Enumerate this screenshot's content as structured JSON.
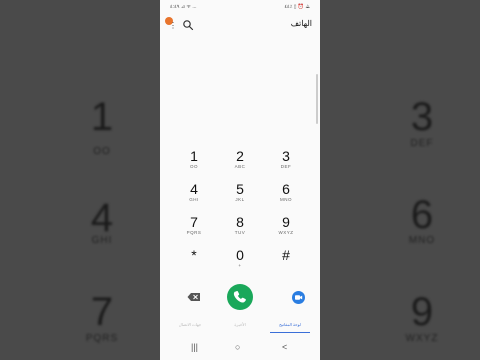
{
  "status": {
    "left": "٤:٤٩ ⊿ ᯤ ...",
    "right": "٤٤٪ ▯ ⏰ ⟁"
  },
  "app": {
    "title": "الهاتف",
    "badge_color": "#e8742c"
  },
  "keypad": [
    {
      "digit": "1",
      "sub": "OO"
    },
    {
      "digit": "2",
      "sub": "ABC"
    },
    {
      "digit": "3",
      "sub": "DEF"
    },
    {
      "digit": "4",
      "sub": "GHI"
    },
    {
      "digit": "5",
      "sub": "JKL"
    },
    {
      "digit": "6",
      "sub": "MNO"
    },
    {
      "digit": "7",
      "sub": "PQRS"
    },
    {
      "digit": "8",
      "sub": "TUV"
    },
    {
      "digit": "9",
      "sub": "WXYZ"
    },
    {
      "digit": "*",
      "sub": ""
    },
    {
      "digit": "0",
      "sub": "+"
    },
    {
      "digit": "#",
      "sub": ""
    }
  ],
  "tabs": [
    "لوحة المفاتيح",
    "الأخيرة",
    "جهات الاتصال"
  ],
  "background": {
    "left": [
      {
        "digit": "1",
        "sub": "OO"
      },
      {
        "digit": "4",
        "sub": "GHI"
      },
      {
        "digit": "7",
        "sub": "PQRS"
      }
    ],
    "right": [
      {
        "digit": "3",
        "sub": "DEF"
      },
      {
        "digit": "6",
        "sub": "MNO"
      },
      {
        "digit": "9",
        "sub": "WXYZ"
      }
    ]
  },
  "colors": {
    "call": "#1aa85a",
    "accent": "#3a6fd8",
    "duo": "#2a7de1"
  },
  "nav": {
    "recent": "|||",
    "home": "○",
    "back": "<"
  }
}
